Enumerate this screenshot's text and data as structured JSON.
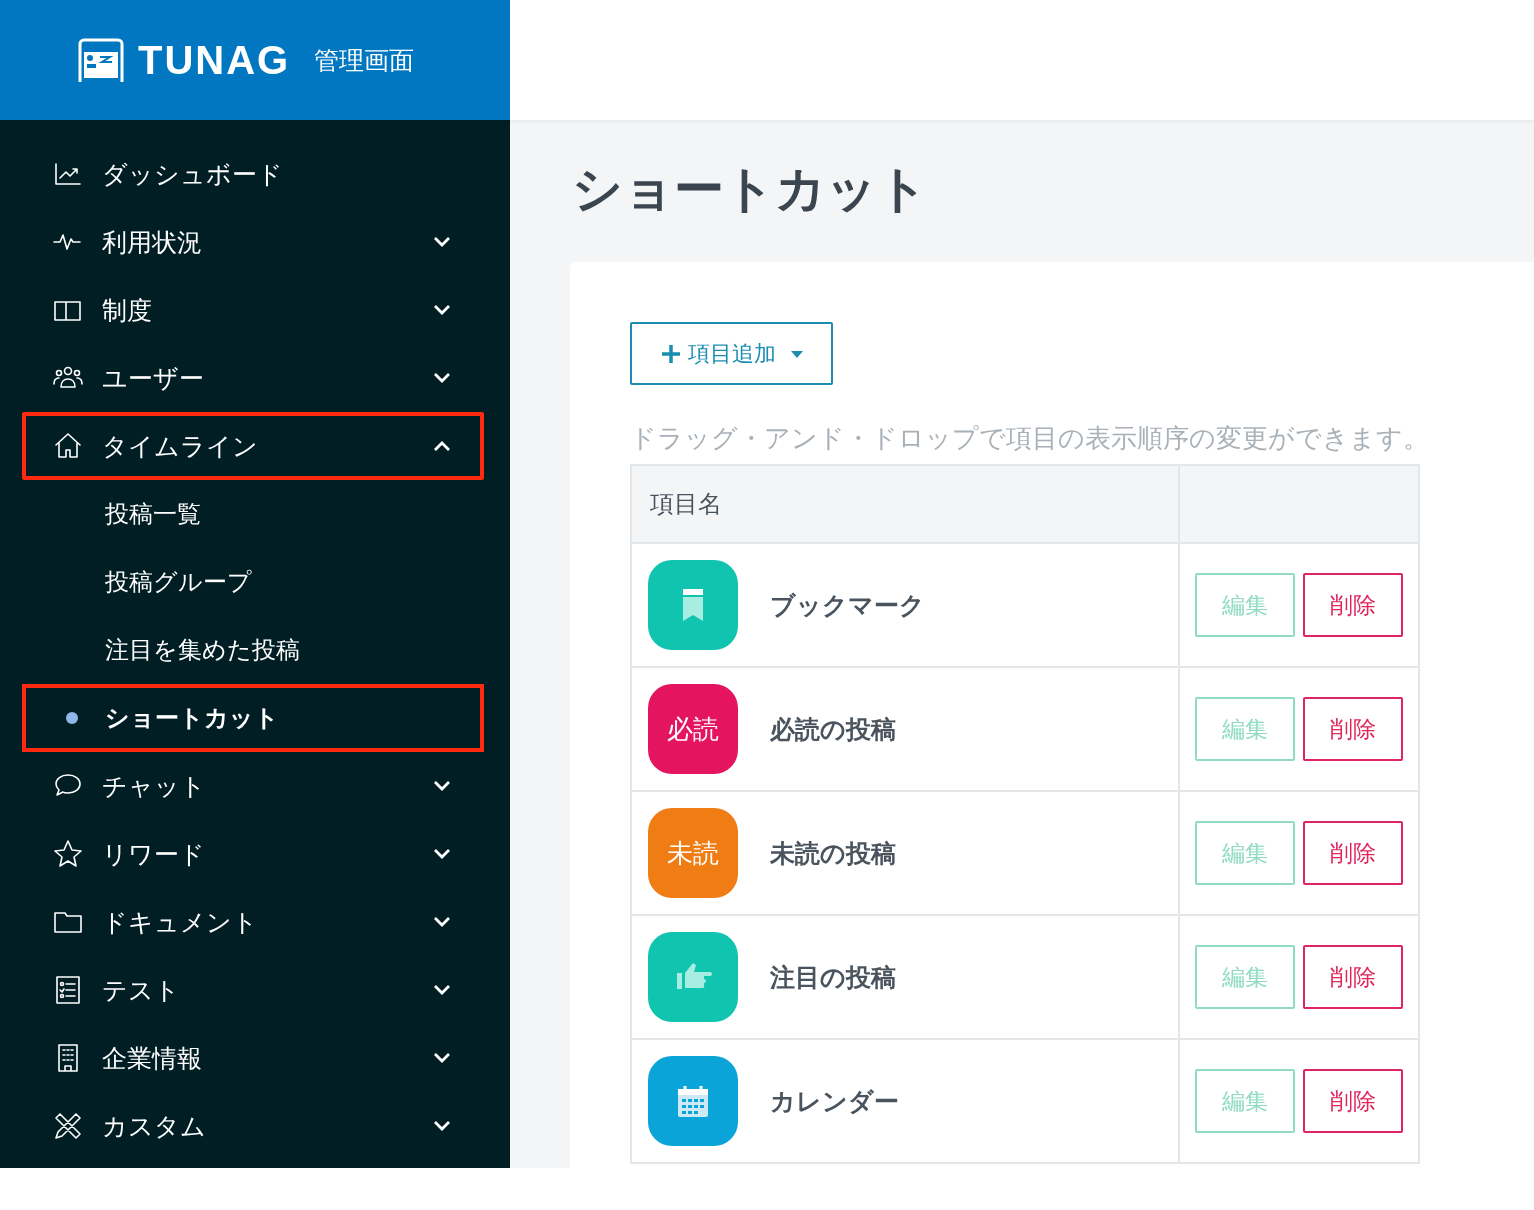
{
  "header": {
    "logo_text": "TUNAG",
    "subtitle": "管理画面"
  },
  "sidebar": {
    "items": [
      {
        "label": "ダッシュボード",
        "kind": "link",
        "highlighted": false
      },
      {
        "label": "利用状況",
        "kind": "group",
        "expanded": false,
        "highlighted": false
      },
      {
        "label": "制度",
        "kind": "group",
        "expanded": false,
        "highlighted": false
      },
      {
        "label": "ユーザー",
        "kind": "group",
        "expanded": false,
        "highlighted": false
      },
      {
        "label": "タイムライン",
        "kind": "group",
        "expanded": true,
        "highlighted": true,
        "children": [
          {
            "label": "投稿一覧",
            "selected": false,
            "highlighted": false
          },
          {
            "label": "投稿グループ",
            "selected": false,
            "highlighted": false
          },
          {
            "label": "注目を集めた投稿",
            "selected": false,
            "highlighted": false
          },
          {
            "label": "ショートカット",
            "selected": true,
            "highlighted": true
          }
        ]
      },
      {
        "label": "チャット",
        "kind": "group",
        "expanded": false,
        "highlighted": false
      },
      {
        "label": "リワード",
        "kind": "group",
        "expanded": false,
        "highlighted": false
      },
      {
        "label": "ドキュメント",
        "kind": "group",
        "expanded": false,
        "highlighted": false
      },
      {
        "label": "テスト",
        "kind": "group",
        "expanded": false,
        "highlighted": false
      },
      {
        "label": "企業情報",
        "kind": "group",
        "expanded": false,
        "highlighted": false
      },
      {
        "label": "カスタム",
        "kind": "group",
        "expanded": false,
        "highlighted": false
      }
    ]
  },
  "page": {
    "title": "ショートカット"
  },
  "add_button": {
    "label": "項目追加"
  },
  "hint": "ドラッグ・アンド・ドロップで項目の表示順序の変更ができます。",
  "table": {
    "columns": [
      "項目名"
    ],
    "rows": [
      {
        "name": "ブックマーク",
        "kind": "bookmark",
        "color": "#10c4b0",
        "edit": "編集",
        "delete": "削除"
      },
      {
        "name": "必読の投稿",
        "kind": "text",
        "badge_text": "必読",
        "color": "#e4145e",
        "edit": "編集",
        "delete": "削除"
      },
      {
        "name": "未読の投稿",
        "kind": "text",
        "badge_text": "未読",
        "color": "#f07c14",
        "edit": "編集",
        "delete": "削除"
      },
      {
        "name": "注目の投稿",
        "kind": "pointer",
        "color": "#10c4b0",
        "edit": "編集",
        "delete": "削除"
      },
      {
        "name": "カレンダー",
        "kind": "calendar",
        "color": "#0aa4d8",
        "edit": "編集",
        "delete": "削除"
      }
    ]
  }
}
